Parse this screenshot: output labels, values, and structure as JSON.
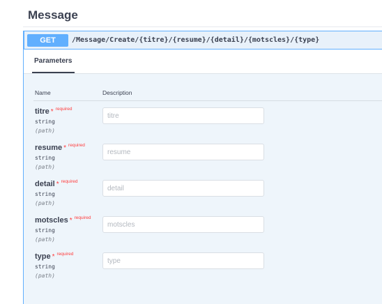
{
  "section": {
    "title": "Message"
  },
  "operation": {
    "method": "GET",
    "path": "/Message/Create/{titre}/{resume}/{detail}/{motscles}/{type}"
  },
  "tab": {
    "label": "Parameters"
  },
  "columns": {
    "name": "Name",
    "description": "Description"
  },
  "parameters": [
    {
      "name": "titre",
      "star": "*",
      "required": "required",
      "type": "string",
      "in": "(path)",
      "placeholder": "titre"
    },
    {
      "name": "resume",
      "star": "*",
      "required": "required",
      "type": "string",
      "in": "(path)",
      "placeholder": "resume"
    },
    {
      "name": "detail",
      "star": "*",
      "required": "required",
      "type": "string",
      "in": "(path)",
      "placeholder": "detail"
    },
    {
      "name": "motscles",
      "star": "*",
      "required": "required",
      "type": "string",
      "in": "(path)",
      "placeholder": "motscles"
    },
    {
      "name": "type",
      "star": "*",
      "required": "required",
      "type": "string",
      "in": "(path)",
      "placeholder": "type"
    }
  ]
}
